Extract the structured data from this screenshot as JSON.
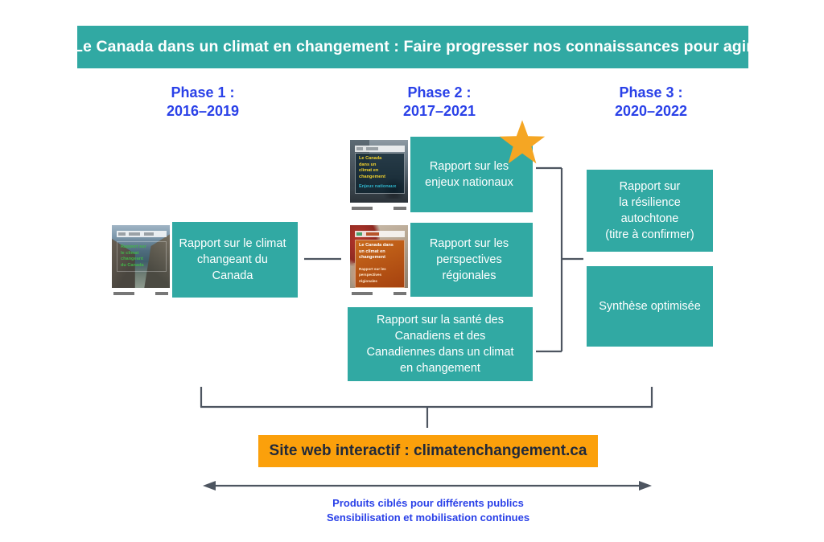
{
  "header": {
    "title": "Le Canada dans un climat en changement : Faire progresser nos connaissances pour agir",
    "background": "#31A9A3",
    "text_color": "#FFFFFF"
  },
  "colors": {
    "teal": "#31A9A3",
    "orange": "#FBA00B",
    "blue": "#2A41E8",
    "line": "#4D5560",
    "star": "#F5A623"
  },
  "phases": [
    {
      "name": "Phase 1 :",
      "years": "2016–2019"
    },
    {
      "name": "Phase 2 :",
      "years": "2017–2021"
    },
    {
      "name": "Phase 3 :",
      "years": "2020–2022"
    }
  ],
  "boxes": {
    "climat": {
      "label_lines": [
        "Rapport sur le climat",
        "changeant du Canada"
      ],
      "thumbnail": {
        "cover_title_lines": [
          "Rapport sur",
          "le climat",
          "changeant",
          "du Canada"
        ]
      }
    },
    "enjeux": {
      "label_lines": [
        "Rapport sur les",
        "enjeux nationaux"
      ],
      "thumbnail": {
        "cover_title_lines": [
          "Le Canada",
          "dans un",
          "climat en",
          "changement"
        ],
        "cover_subtitle": "Enjeux nationaux"
      }
    },
    "regional": {
      "label_lines": [
        "Rapport sur les",
        "perspectives régionales"
      ],
      "thumbnail": {
        "cover_title_lines": [
          "Le Canada dans",
          "un climat en",
          "changement"
        ],
        "cover_subtitle": "Rapport sur les perspectives régionales"
      }
    },
    "sante": {
      "label_lines": [
        "Rapport sur la santé des",
        "Canadiens et des",
        "Canadiennes dans un climat",
        "en changement"
      ]
    },
    "resilience": {
      "label_lines": [
        "Rapport sur",
        "la résilience autochtone",
        "(titre à confirmer)"
      ]
    },
    "synthese": {
      "label_lines": [
        "Synthèse optimisée"
      ]
    }
  },
  "cta": {
    "text": "Site web interactif : climatenchangement.ca"
  },
  "bottom_caption": {
    "lines": [
      "Produits ciblés pour différents publics",
      "Sensibilisation et mobilisation continues"
    ]
  },
  "star": {
    "name": "star-highlight"
  }
}
